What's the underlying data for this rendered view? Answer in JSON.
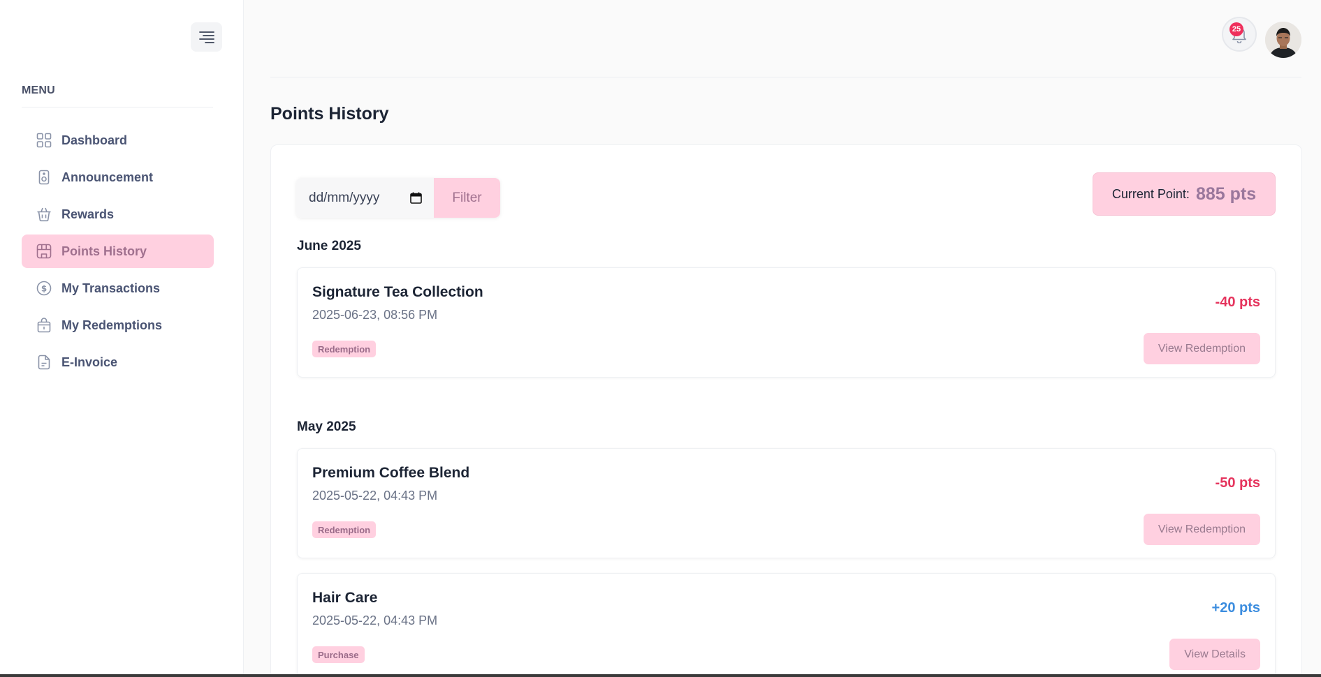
{
  "sidebar": {
    "menu_title": "MENU",
    "items": [
      {
        "label": "Dashboard",
        "icon": "grid-icon"
      },
      {
        "label": "Announcement",
        "icon": "speaker-icon"
      },
      {
        "label": "Rewards",
        "icon": "basket-icon"
      },
      {
        "label": "Points History",
        "icon": "store-icon",
        "active": true
      },
      {
        "label": "My Transactions",
        "icon": "dollar-circle-icon"
      },
      {
        "label": "My Redemptions",
        "icon": "gift-bag-icon"
      },
      {
        "label": "E-Invoice",
        "icon": "document-icon"
      }
    ]
  },
  "header": {
    "notification_count": "25"
  },
  "page": {
    "title": "Points History",
    "date_placeholder": "dd/mm/yyyy",
    "filter_label": "Filter",
    "current_point_label": "Current Point:",
    "current_point_value": "885 pts"
  },
  "history": [
    {
      "month": "June 2025",
      "entries": [
        {
          "title": "Signature Tea Collection",
          "datetime": "2025-06-23, 08:56 PM",
          "tag": "Redemption",
          "points": "-40 pts",
          "action": "View Redemption"
        }
      ]
    },
    {
      "month": "May 2025",
      "entries": [
        {
          "title": "Premium Coffee Blend",
          "datetime": "2025-05-22, 04:43 PM",
          "tag": "Redemption",
          "points": "-50 pts",
          "action": "View Redemption"
        },
        {
          "title": "Hair Care",
          "datetime": "2025-05-22, 04:43 PM",
          "tag": "Purchase",
          "points": "+20 pts",
          "action": "View Details"
        }
      ]
    }
  ],
  "colors": {
    "accent_pink": "#ffd0e0",
    "negative": "#e5345d",
    "positive": "#3c8ddf"
  }
}
